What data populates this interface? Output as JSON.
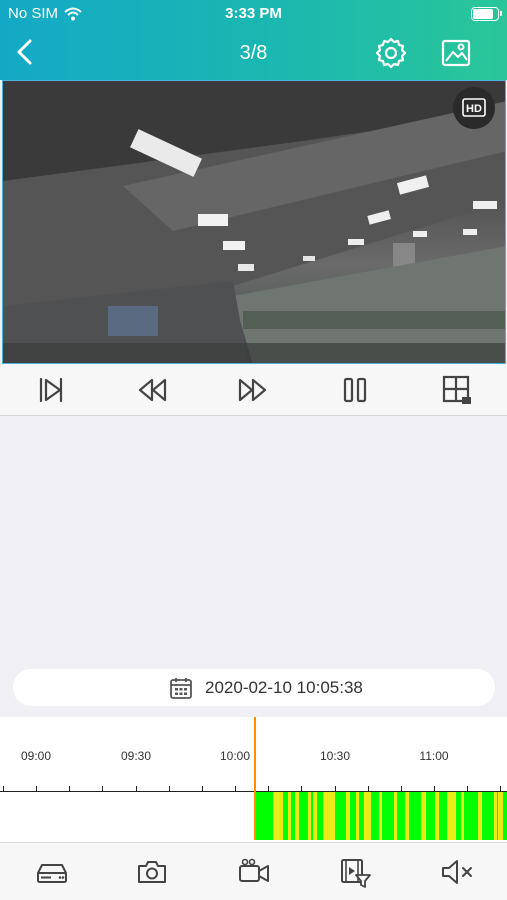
{
  "status_bar": {
    "carrier": "No SIM",
    "time": "3:33 PM"
  },
  "nav": {
    "page_indicator": "3/8",
    "back_icon": "chevron-left-icon",
    "settings_icon": "gear-icon",
    "gallery_icon": "image-icon"
  },
  "video": {
    "hd_badge": "HD"
  },
  "controls": [
    "frame-step-icon",
    "rewind-icon",
    "fast-forward-icon",
    "pause-icon",
    "grid-layout-icon"
  ],
  "playback": {
    "datetime": "2020-02-10 10:05:38"
  },
  "timeline": {
    "tick_labels": [
      "09:00",
      "09:30",
      "10:00",
      "10:30",
      "11:00"
    ],
    "current_time": "10:05:38",
    "colors": {
      "recording": "#00ff00",
      "motion_event": "#eaea16",
      "cursor": "#ff8c00"
    }
  },
  "toolbar": [
    "nvr-icon",
    "camera-icon",
    "video-record-icon",
    "video-filter-icon",
    "speaker-mute-icon"
  ],
  "colors": {
    "header_gradient_start": "#13a9c6",
    "header_gradient_end": "#2ac699",
    "background": "#efeff4"
  }
}
